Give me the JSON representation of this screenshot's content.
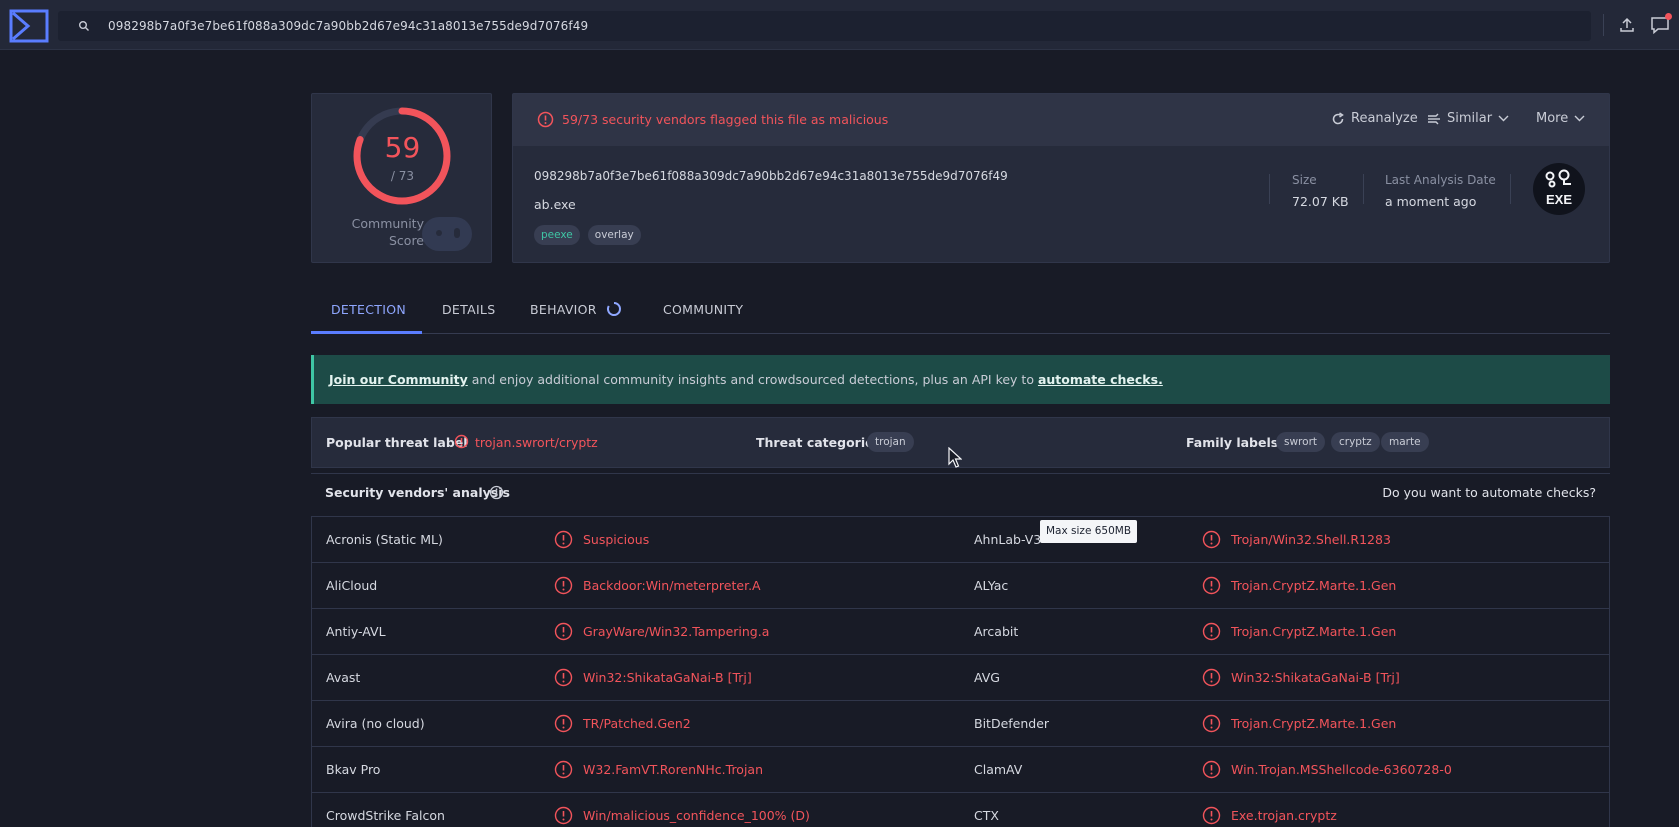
{
  "search": {
    "value": "098298b7a0f3e7be61f088a309dc7a90bb2d67e94c31a8013e755de9d7076f49"
  },
  "score": {
    "detected": "59",
    "total": "/ 73",
    "community_label_1": "Community",
    "community_label_2": "Score"
  },
  "summary": {
    "alert": "59/73 security vendors flagged this file as malicious",
    "actions": {
      "reanalyze": "Reanalyze",
      "similar": "Similar",
      "more": "More"
    },
    "hash": "098298b7a0f3e7be61f088a309dc7a90bb2d67e94c31a8013e755de9d7076f49",
    "file_name": "ab.exe",
    "tags": [
      "peexe",
      "overlay"
    ],
    "size_label": "Size",
    "size_value": "72.07 KB",
    "date_label": "Last Analysis Date",
    "date_value": "a moment ago",
    "badge_text": "EXE"
  },
  "tabs": [
    "DETECTION",
    "DETAILS",
    "BEHAVIOR",
    "COMMUNITY"
  ],
  "banner": {
    "link1": "Join our Community",
    "middle": " and enjoy additional community insights and crowdsourced detections, plus an API key to ",
    "link2": "automate checks."
  },
  "threat": {
    "popular_label": "Popular threat label",
    "popular_value": "trojan.swrort/cryptz",
    "categories_label": "Threat categories",
    "categories": [
      "trojan"
    ],
    "family_label": "Family labels",
    "families": [
      "swrort",
      "cryptz",
      "marte"
    ]
  },
  "vendors_header": {
    "title": "Security vendors' analysis",
    "automate": "Do you want to automate checks?"
  },
  "tooltip": "Max size 650MB",
  "vendors": [
    {
      "left_name": "Acronis (Static ML)",
      "left_result": "Suspicious",
      "right_name": "AhnLab-V3",
      "right_result": "Trojan/Win32.Shell.R1283"
    },
    {
      "left_name": "AliCloud",
      "left_result": "Backdoor:Win/meterpreter.A",
      "right_name": "ALYac",
      "right_result": "Trojan.CryptZ.Marte.1.Gen"
    },
    {
      "left_name": "Antiy-AVL",
      "left_result": "GrayWare/Win32.Tampering.a",
      "right_name": "Arcabit",
      "right_result": "Trojan.CryptZ.Marte.1.Gen"
    },
    {
      "left_name": "Avast",
      "left_result": "Win32:ShikataGaNai-B [Trj]",
      "right_name": "AVG",
      "right_result": "Win32:ShikataGaNai-B [Trj]"
    },
    {
      "left_name": "Avira (no cloud)",
      "left_result": "TR/Patched.Gen2",
      "right_name": "BitDefender",
      "right_result": "Trojan.CryptZ.Marte.1.Gen"
    },
    {
      "left_name": "Bkav Pro",
      "left_result": "W32.FamVT.RorenNHc.Trojan",
      "right_name": "ClamAV",
      "right_result": "Win.Trojan.MSShellcode-6360728-0"
    },
    {
      "left_name": "CrowdStrike Falcon",
      "left_result": "Win/malicious_confidence_100% (D)",
      "right_name": "CTX",
      "right_result": "Exe.trojan.cryptz"
    }
  ],
  "colors": {
    "malicious": "#f2545b",
    "accent": "#5a7dff",
    "background": "#181b26",
    "banner": "#1d4b47"
  }
}
